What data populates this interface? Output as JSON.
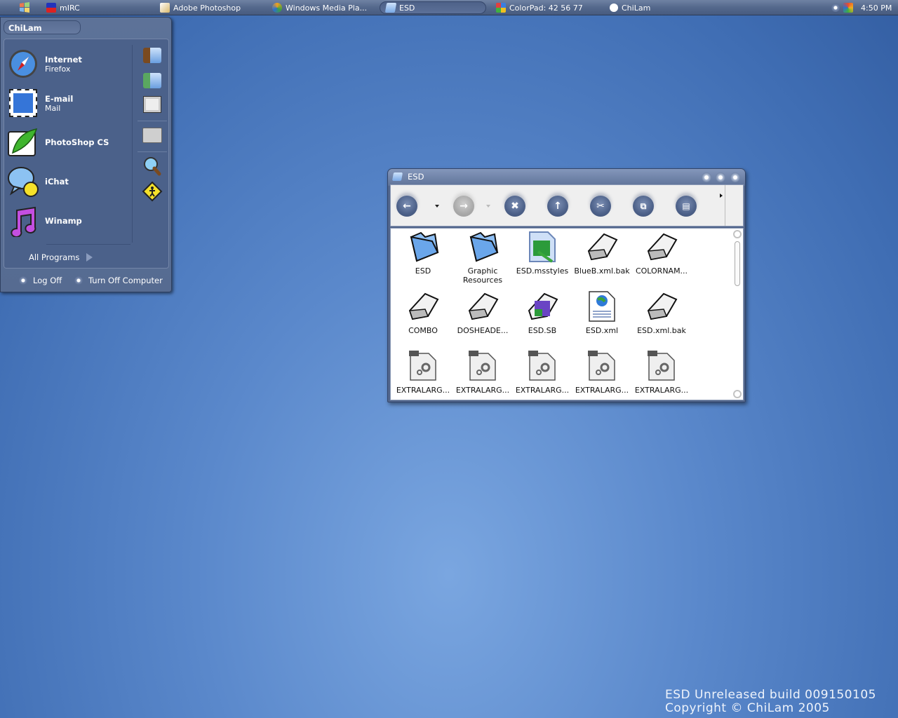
{
  "taskbar": {
    "start_icon": "windows-logo-icon",
    "items": [
      {
        "label": "mIRC",
        "icon": "mirc-icon",
        "active": false
      },
      {
        "label": "Adobe Photoshop",
        "icon": "photoshop-icon",
        "active": false
      },
      {
        "label": "Windows Media Pla...",
        "icon": "media-player-icon",
        "active": false
      },
      {
        "label": "ESD",
        "icon": "folder-icon",
        "active": true
      },
      {
        "label": "ColorPad: 42 56 77",
        "icon": "colorpad-icon",
        "active": false
      },
      {
        "label": "ChiLam",
        "icon": "chat-bubble-icon",
        "active": false
      }
    ],
    "tray_icons": [
      "tray-dot-icon",
      "msn-butterfly-icon"
    ],
    "clock": "4:50 PM"
  },
  "start_menu": {
    "user": "ChiLam",
    "programs": [
      {
        "title": "Internet",
        "subtitle": "Firefox",
        "icon": "compass-icon"
      },
      {
        "title": "E-mail",
        "subtitle": "Mail",
        "icon": "stamp-icon"
      },
      {
        "title": "PhotoShop CS",
        "subtitle": "",
        "icon": "feather-icon"
      },
      {
        "title": "iChat",
        "subtitle": "",
        "icon": "ichat-icon"
      },
      {
        "title": "Winamp",
        "subtitle": "",
        "icon": "music-note-icon"
      }
    ],
    "places": [
      "my-documents-icon",
      "my-pictures-icon",
      "my-computer-icon",
      "control-panel-icon",
      "search-icon",
      "run-icon"
    ],
    "all_programs": "All Programs",
    "log_off": "Log Off",
    "turn_off": "Turn Off Computer"
  },
  "window": {
    "title": "ESD",
    "toolbar": [
      "back",
      "forward",
      "stop",
      "up",
      "cut",
      "copy",
      "paste"
    ],
    "files": [
      {
        "name": "ESD",
        "type": "folder"
      },
      {
        "name": "Graphic Resources",
        "type": "folder"
      },
      {
        "name": "ESD.msstyles",
        "type": "msstyles"
      },
      {
        "name": "BlueB.xml.bak",
        "type": "generic"
      },
      {
        "name": "COLORNAM...",
        "type": "generic"
      },
      {
        "name": "COMBO",
        "type": "generic"
      },
      {
        "name": "DOSHEADE...",
        "type": "generic"
      },
      {
        "name": "ESD.SB",
        "type": "sb"
      },
      {
        "name": "ESD.xml",
        "type": "xml"
      },
      {
        "name": "ESD.xml.bak",
        "type": "generic"
      },
      {
        "name": "EXTRALARG...",
        "type": "ini"
      },
      {
        "name": "EXTRALARG...",
        "type": "ini"
      },
      {
        "name": "EXTRALARG...",
        "type": "ini"
      },
      {
        "name": "EXTRALARG...",
        "type": "ini"
      },
      {
        "name": "EXTRALARG...",
        "type": "ini"
      }
    ]
  },
  "watermark": {
    "line1": "ESD Unreleased build 009150105",
    "line2": "Copyright © ChiLam 2005"
  }
}
